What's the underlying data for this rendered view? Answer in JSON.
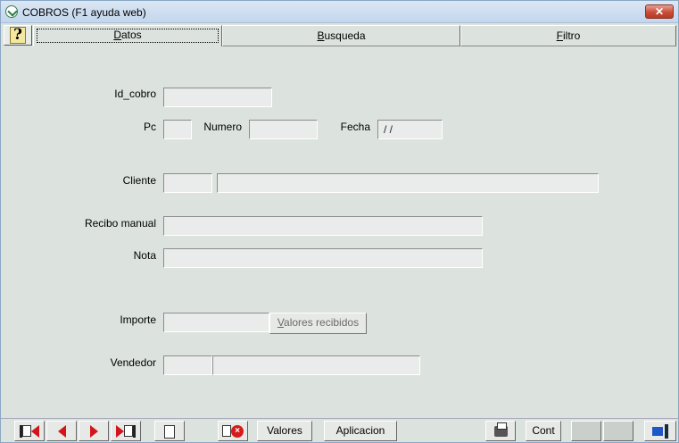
{
  "window": {
    "title": "COBROS (F1 ayuda web)",
    "close_label": "✕"
  },
  "tabs": [
    {
      "label": "Datos",
      "active": true
    },
    {
      "label": "Busqueda",
      "active": false
    },
    {
      "label": "Filtro",
      "active": false
    }
  ],
  "help_label": "?",
  "form": {
    "id_cobro": {
      "label": "Id_cobro",
      "value": ""
    },
    "pc": {
      "label": "Pc",
      "value": ""
    },
    "numero": {
      "label": "Numero",
      "value": ""
    },
    "fecha": {
      "label": "Fecha",
      "value": " / /"
    },
    "cliente": {
      "label": "Cliente",
      "code": "",
      "name": ""
    },
    "recibo_manual": {
      "label": "Recibo manual",
      "value": ""
    },
    "nota": {
      "label": "Nota",
      "value": ""
    },
    "importe": {
      "label": "Importe",
      "value": ""
    },
    "valores_recibidos_button": "Valores recibidos",
    "vendedor": {
      "label": "Vendedor",
      "code": "",
      "name": ""
    }
  },
  "toolbar": {
    "first_icon": "first-record-icon",
    "prev_icon": "previous-record-icon",
    "next_icon": "next-record-icon",
    "last_icon": "last-record-icon",
    "new_icon": "new-record-icon",
    "delete_icon": "delete-record-icon",
    "valores_label": "Valores",
    "aplicacion_label": "Aplicacion",
    "print_icon": "printer-icon",
    "cont_label": "Cont",
    "exit_icon": "exit-icon"
  }
}
